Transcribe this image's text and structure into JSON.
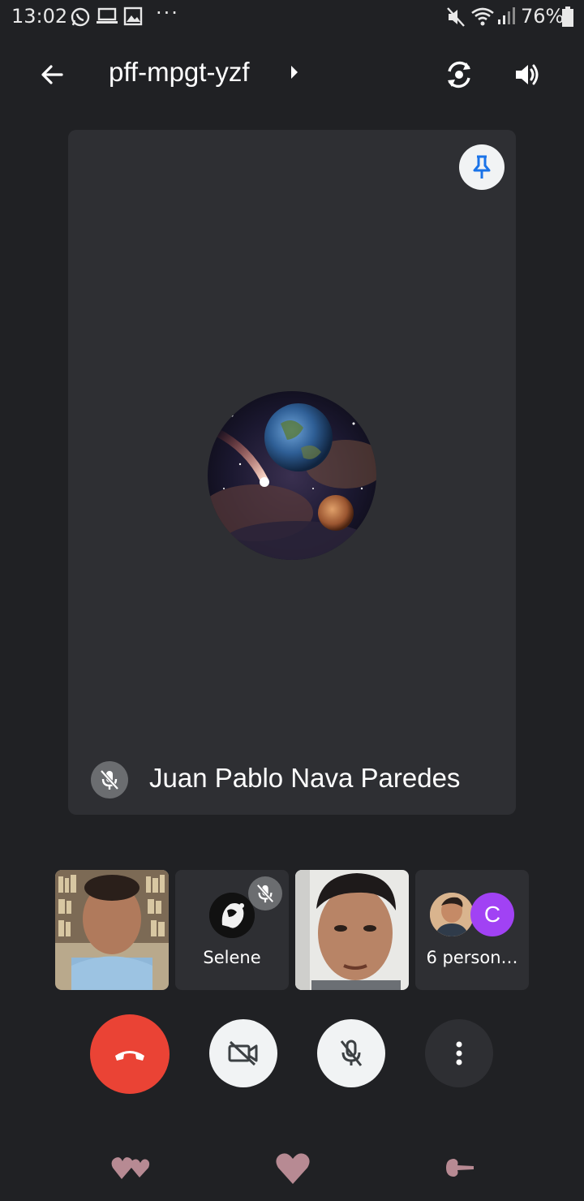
{
  "status_bar": {
    "time": "13:02",
    "battery": "76%",
    "overflow": "···",
    "icons": [
      "whatsapp-icon",
      "laptop-icon",
      "gallery-icon",
      "mute-icon",
      "wifi-icon",
      "signal-icon",
      "battery-icon"
    ]
  },
  "top_bar": {
    "meeting_code": "pff-mpgt-yzf",
    "icons": [
      "back-arrow-icon",
      "caret-right-icon",
      "switch-camera-icon",
      "speaker-icon"
    ]
  },
  "main_tile": {
    "participant_name": "Juan Pablo Nava Paredes",
    "muted": true,
    "pinned": true,
    "avatar": "space-planets-avatar"
  },
  "thumbnails": [
    {
      "type": "video",
      "description_icon": "person-video"
    },
    {
      "type": "avatar",
      "label": "Selene",
      "muted": true
    },
    {
      "type": "video",
      "description_icon": "person-video"
    },
    {
      "type": "group",
      "label": "6 person…",
      "avatar_letter": "C"
    }
  ],
  "controls": {
    "icons": [
      "end-call-icon",
      "camera-off-icon",
      "mic-off-icon",
      "more-vert-icon"
    ]
  },
  "colors": {
    "background": "#202124",
    "tile": "#2e2f33",
    "end_call": "#ea4335",
    "accent_blue": "#1a73e8",
    "avatar_purple": "#a142f4",
    "nav_pink": "#b78a93"
  },
  "bottom_nav": {
    "icons": [
      "recents-hearts-icon",
      "home-heart-icon",
      "back-arrow-nav-icon"
    ]
  }
}
